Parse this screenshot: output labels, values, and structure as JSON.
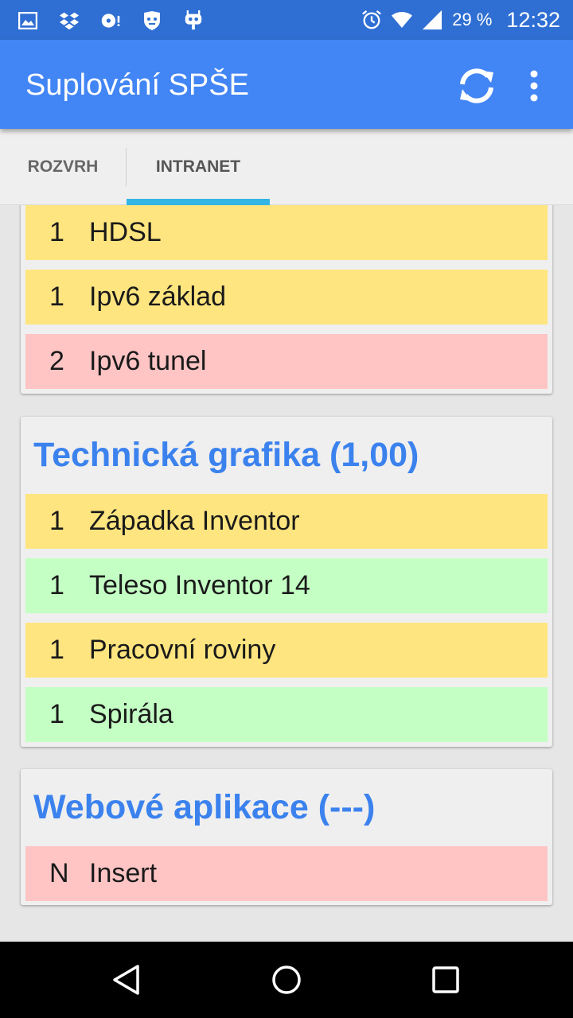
{
  "status_bar": {
    "icons": [
      "image-icon",
      "dropbox-icon",
      "disc-alert-icon",
      "shield-face-icon",
      "android-robot-icon"
    ],
    "battery": "29 %",
    "time": "12:32"
  },
  "app_bar": {
    "title": "Suplování SPŠE",
    "refresh_icon": "refresh-icon",
    "menu_icon": "more-vert-icon"
  },
  "tabs": [
    {
      "label": "ROZVRH",
      "selected": false
    },
    {
      "label": "INTRANET",
      "selected": true
    }
  ],
  "colors": {
    "status_bar": "#2f6fd3",
    "app_bar": "#4285f4",
    "tab_indicator": "#33b5e5",
    "card_title": "#3b82ee",
    "yellow": "#ffe57f",
    "red": "#ffc4c4",
    "green": "#c4ffc4"
  },
  "cards": [
    {
      "title": "",
      "rows": [
        {
          "count": "1",
          "name": "HDSL",
          "color": "yellow"
        },
        {
          "count": "1",
          "name": "Ipv6 základ",
          "color": "yellow"
        },
        {
          "count": "2",
          "name": "Ipv6 tunel",
          "color": "red"
        }
      ]
    },
    {
      "title": "Technická grafika (1,00)",
      "rows": [
        {
          "count": "1",
          "name": "Západka Inventor",
          "color": "yellow"
        },
        {
          "count": "1",
          "name": "Teleso Inventor 14",
          "color": "green"
        },
        {
          "count": "1",
          "name": "Pracovní roviny",
          "color": "yellow"
        },
        {
          "count": "1",
          "name": "Spirála",
          "color": "green"
        }
      ]
    },
    {
      "title": "Webové aplikace (---)",
      "rows": [
        {
          "count": "N",
          "name": "Insert",
          "color": "red"
        }
      ]
    }
  ],
  "nav_bar": {
    "icons": [
      "back-icon",
      "home-icon",
      "recents-icon"
    ]
  }
}
